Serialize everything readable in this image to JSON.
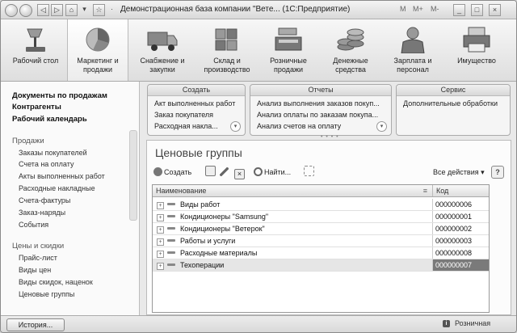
{
  "window": {
    "title": "Демонстрационная база компании \"Вете...  (1С:Предприятие)",
    "title_controls": [
      "M",
      "M+",
      "M-",
      "□",
      "×"
    ]
  },
  "ribbon": {
    "items": [
      {
        "label": "Рабочий стол",
        "icon": "desk-lamp-icon"
      },
      {
        "label": "Маркетинг и продажи",
        "icon": "pie-chart-icon",
        "active": true
      },
      {
        "label": "Снабжение и закупки",
        "icon": "truck-icon"
      },
      {
        "label": "Склад и производство",
        "icon": "warehouse-boxes-icon"
      },
      {
        "label": "Розничные продажи",
        "icon": "cash-register-icon"
      },
      {
        "label": "Денежные средства",
        "icon": "coin-stack-icon"
      },
      {
        "label": "Зарплата и персонал",
        "icon": "worker-icon"
      },
      {
        "label": "Имущество",
        "icon": "printer-icon"
      }
    ]
  },
  "left_panel": {
    "bold_links": [
      "Документы по продажам",
      "Контрагенты",
      "Рабочий календарь"
    ],
    "sections": [
      {
        "title": "Продажи",
        "items": [
          "Заказы покупателей",
          "Счета на оплату",
          "Акты выполненных работ",
          "Расходные накладные",
          "Счета-фактуры",
          "Заказ-наряды",
          "События"
        ]
      },
      {
        "title": "Цены и скидки",
        "items": [
          "Прайс-лист",
          "Виды цен",
          "Виды скидок, наценок",
          "Ценовые группы"
        ]
      }
    ]
  },
  "action_panels": {
    "create": {
      "title": "Создать",
      "items": [
        "Акт выполненных работ",
        "Заказ покупателя",
        "Расходная накла..."
      ]
    },
    "reports": {
      "title": "Отчеты",
      "items": [
        "Анализ выполнения заказов покуп...",
        "Анализ оплаты по заказам покупа...",
        "Анализ счетов на оплату"
      ]
    },
    "service": {
      "title": "Сервис",
      "items": [
        "Дополнительные обработки"
      ]
    }
  },
  "form": {
    "title": "Ценовые группы",
    "toolbar": {
      "create": "Создать",
      "find": "Найти...",
      "all_actions": "Все действия",
      "help": "?"
    },
    "columns": {
      "name": "Наименование",
      "code": "Код"
    },
    "rows": [
      {
        "name": "Виды работ",
        "code": "000000006"
      },
      {
        "name": "Кондиционеры \"Samsung\"",
        "code": "000000001"
      },
      {
        "name": "Кондиционеры \"Ветерок\"",
        "code": "000000002"
      },
      {
        "name": "Работы и услуги",
        "code": "000000003"
      },
      {
        "name": "Расходные материалы",
        "code": "000000008"
      },
      {
        "name": "Техоперации",
        "code": "000000007",
        "selected": true
      }
    ]
  },
  "status_bar": {
    "history_button": "История...",
    "status": "Розничная"
  }
}
